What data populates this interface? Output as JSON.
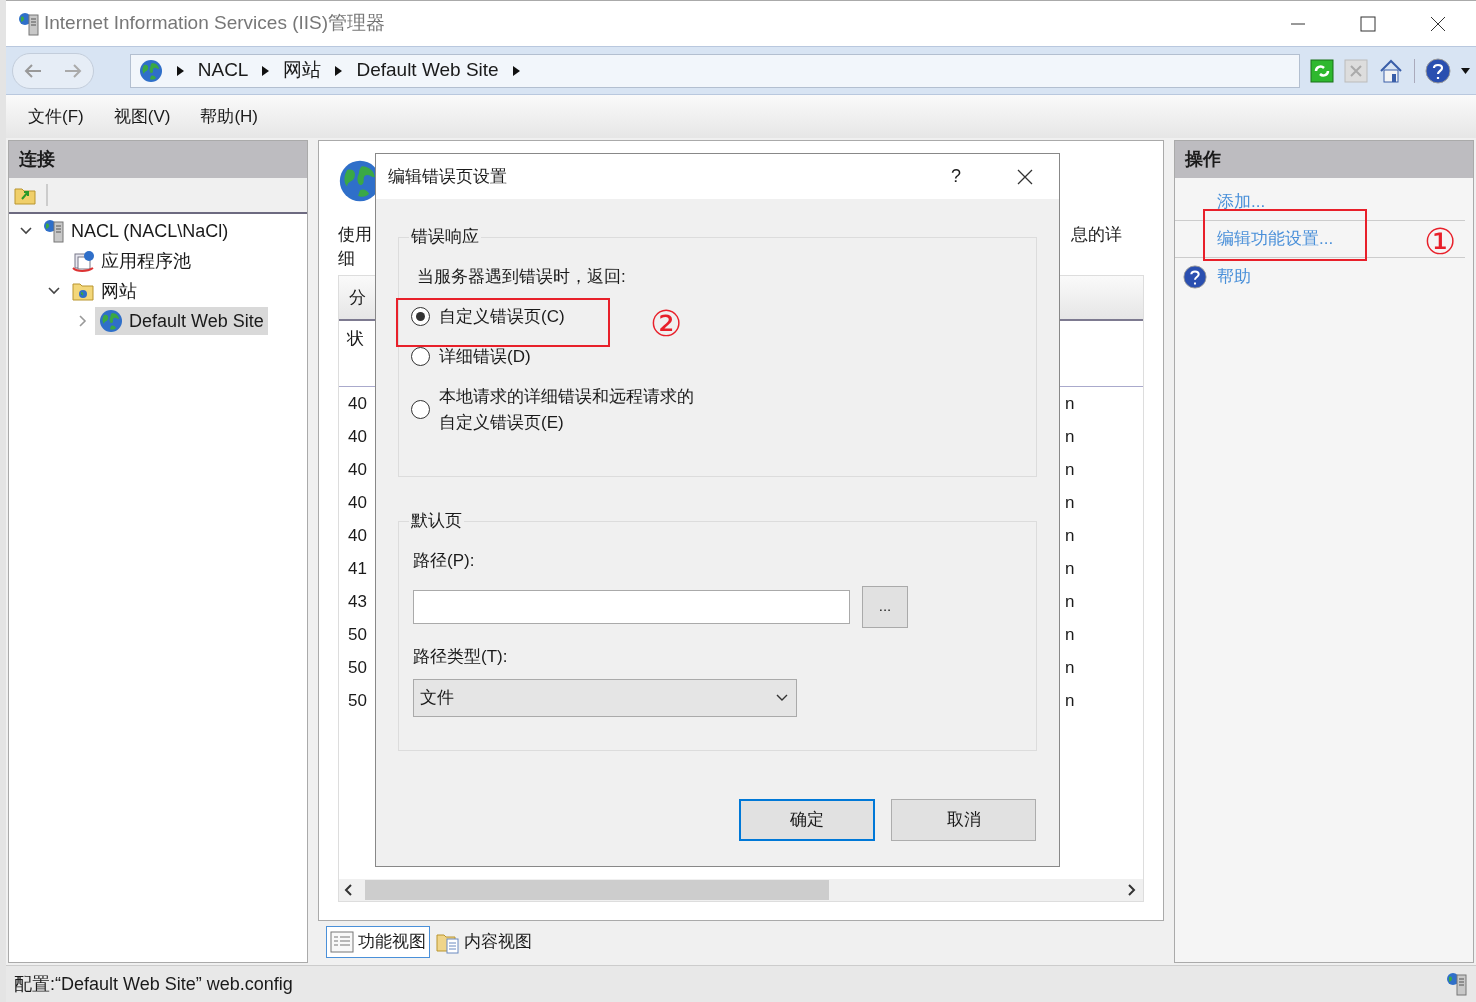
{
  "window": {
    "title": "Internet Information Services (IIS)管理器"
  },
  "address_bar": {
    "crumbs": [
      "NACL",
      "网站",
      "Default Web Site"
    ]
  },
  "menu": [
    "文件(F)",
    "视图(V)",
    "帮助(H)"
  ],
  "connections": {
    "title": "连接",
    "tree": [
      {
        "label": "NACL (NACL\\NaCl)",
        "kind": "server",
        "expanded": true,
        "selected": false,
        "children": [
          {
            "label": "应用程序池",
            "kind": "pool",
            "selected": false
          },
          {
            "label": "网站",
            "kind": "sites",
            "expanded": true,
            "selected": false,
            "children": [
              {
                "label": "Default Web Site",
                "kind": "site",
                "expanded": false,
                "selected": true
              }
            ]
          }
        ]
      }
    ]
  },
  "feature_page": {
    "description_left": [
      "使用",
      "细"
    ],
    "description_right": "息的详",
    "table": {
      "header": "分",
      "subheader": "状",
      "rows": [
        {
          "column_1": "40",
          "column_2": "n"
        },
        {
          "column_1": "40",
          "column_2": "n"
        },
        {
          "column_1": "40",
          "column_2": "n"
        },
        {
          "column_1": "40",
          "column_2": "n"
        },
        {
          "column_1": "40",
          "column_2": "n"
        },
        {
          "column_1": "41",
          "column_2": "n"
        },
        {
          "column_1": "43",
          "column_2": "n"
        },
        {
          "column_1": "50",
          "column_2": "n"
        },
        {
          "column_1": "50",
          "column_2": "n"
        },
        {
          "column_1": "50",
          "column_2": "n"
        }
      ]
    }
  },
  "view_tabs": [
    {
      "label": "功能视图",
      "selected": true
    },
    {
      "label": "内容视图",
      "selected": false
    }
  ],
  "actions": {
    "title": "操作",
    "items": [
      {
        "label": "添加...",
        "kind": "link"
      },
      {
        "label": "编辑功能设置...",
        "kind": "link"
      },
      {
        "label": "帮助",
        "kind": "help"
      }
    ]
  },
  "status_bar": "配置:“Default Web Site” web.config",
  "dialog": {
    "title": "编辑错误页设置",
    "help": "?",
    "error_response": {
      "legend": "错误响应",
      "prompt": "当服务器遇到错误时，返回:",
      "options": [
        {
          "label": "自定义错误页(C)",
          "selected": true
        },
        {
          "label": "详细错误(D)",
          "selected": false
        },
        {
          "label": "本地请求的详细错误和远程请求的自定义错误页(E)",
          "selected": false
        }
      ]
    },
    "default_page": {
      "legend": "默认页",
      "path_label": "路径(P):",
      "browse": "...",
      "path_type_label": "路径类型(T):",
      "path_type": "文件"
    },
    "buttons": [
      {
        "label": "确定",
        "default": true
      },
      {
        "label": "取消",
        "default": false
      }
    ]
  },
  "annotations": [
    {
      "number": "①"
    },
    {
      "number": "②"
    }
  ]
}
